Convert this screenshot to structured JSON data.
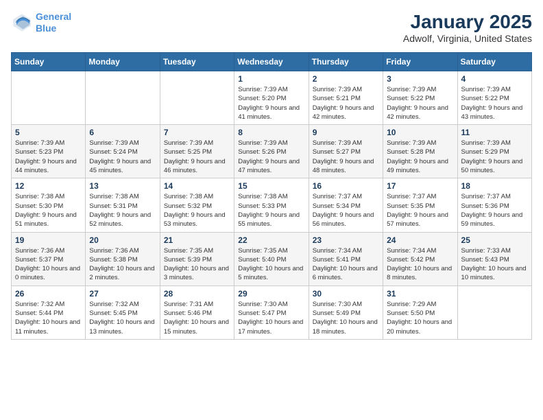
{
  "header": {
    "logo_line1": "General",
    "logo_line2": "Blue",
    "title": "January 2025",
    "subtitle": "Adwolf, Virginia, United States"
  },
  "calendar": {
    "weekdays": [
      "Sunday",
      "Monday",
      "Tuesday",
      "Wednesday",
      "Thursday",
      "Friday",
      "Saturday"
    ],
    "weeks": [
      [
        {
          "day": "",
          "text": ""
        },
        {
          "day": "",
          "text": ""
        },
        {
          "day": "",
          "text": ""
        },
        {
          "day": "1",
          "text": "Sunrise: 7:39 AM\nSunset: 5:20 PM\nDaylight: 9 hours and 41 minutes."
        },
        {
          "day": "2",
          "text": "Sunrise: 7:39 AM\nSunset: 5:21 PM\nDaylight: 9 hours and 42 minutes."
        },
        {
          "day": "3",
          "text": "Sunrise: 7:39 AM\nSunset: 5:22 PM\nDaylight: 9 hours and 42 minutes."
        },
        {
          "day": "4",
          "text": "Sunrise: 7:39 AM\nSunset: 5:22 PM\nDaylight: 9 hours and 43 minutes."
        }
      ],
      [
        {
          "day": "5",
          "text": "Sunrise: 7:39 AM\nSunset: 5:23 PM\nDaylight: 9 hours and 44 minutes."
        },
        {
          "day": "6",
          "text": "Sunrise: 7:39 AM\nSunset: 5:24 PM\nDaylight: 9 hours and 45 minutes."
        },
        {
          "day": "7",
          "text": "Sunrise: 7:39 AM\nSunset: 5:25 PM\nDaylight: 9 hours and 46 minutes."
        },
        {
          "day": "8",
          "text": "Sunrise: 7:39 AM\nSunset: 5:26 PM\nDaylight: 9 hours and 47 minutes."
        },
        {
          "day": "9",
          "text": "Sunrise: 7:39 AM\nSunset: 5:27 PM\nDaylight: 9 hours and 48 minutes."
        },
        {
          "day": "10",
          "text": "Sunrise: 7:39 AM\nSunset: 5:28 PM\nDaylight: 9 hours and 49 minutes."
        },
        {
          "day": "11",
          "text": "Sunrise: 7:39 AM\nSunset: 5:29 PM\nDaylight: 9 hours and 50 minutes."
        }
      ],
      [
        {
          "day": "12",
          "text": "Sunrise: 7:38 AM\nSunset: 5:30 PM\nDaylight: 9 hours and 51 minutes."
        },
        {
          "day": "13",
          "text": "Sunrise: 7:38 AM\nSunset: 5:31 PM\nDaylight: 9 hours and 52 minutes."
        },
        {
          "day": "14",
          "text": "Sunrise: 7:38 AM\nSunset: 5:32 PM\nDaylight: 9 hours and 53 minutes."
        },
        {
          "day": "15",
          "text": "Sunrise: 7:38 AM\nSunset: 5:33 PM\nDaylight: 9 hours and 55 minutes."
        },
        {
          "day": "16",
          "text": "Sunrise: 7:37 AM\nSunset: 5:34 PM\nDaylight: 9 hours and 56 minutes."
        },
        {
          "day": "17",
          "text": "Sunrise: 7:37 AM\nSunset: 5:35 PM\nDaylight: 9 hours and 57 minutes."
        },
        {
          "day": "18",
          "text": "Sunrise: 7:37 AM\nSunset: 5:36 PM\nDaylight: 9 hours and 59 minutes."
        }
      ],
      [
        {
          "day": "19",
          "text": "Sunrise: 7:36 AM\nSunset: 5:37 PM\nDaylight: 10 hours and 0 minutes."
        },
        {
          "day": "20",
          "text": "Sunrise: 7:36 AM\nSunset: 5:38 PM\nDaylight: 10 hours and 2 minutes."
        },
        {
          "day": "21",
          "text": "Sunrise: 7:35 AM\nSunset: 5:39 PM\nDaylight: 10 hours and 3 minutes."
        },
        {
          "day": "22",
          "text": "Sunrise: 7:35 AM\nSunset: 5:40 PM\nDaylight: 10 hours and 5 minutes."
        },
        {
          "day": "23",
          "text": "Sunrise: 7:34 AM\nSunset: 5:41 PM\nDaylight: 10 hours and 6 minutes."
        },
        {
          "day": "24",
          "text": "Sunrise: 7:34 AM\nSunset: 5:42 PM\nDaylight: 10 hours and 8 minutes."
        },
        {
          "day": "25",
          "text": "Sunrise: 7:33 AM\nSunset: 5:43 PM\nDaylight: 10 hours and 10 minutes."
        }
      ],
      [
        {
          "day": "26",
          "text": "Sunrise: 7:32 AM\nSunset: 5:44 PM\nDaylight: 10 hours and 11 minutes."
        },
        {
          "day": "27",
          "text": "Sunrise: 7:32 AM\nSunset: 5:45 PM\nDaylight: 10 hours and 13 minutes."
        },
        {
          "day": "28",
          "text": "Sunrise: 7:31 AM\nSunset: 5:46 PM\nDaylight: 10 hours and 15 minutes."
        },
        {
          "day": "29",
          "text": "Sunrise: 7:30 AM\nSunset: 5:47 PM\nDaylight: 10 hours and 17 minutes."
        },
        {
          "day": "30",
          "text": "Sunrise: 7:30 AM\nSunset: 5:49 PM\nDaylight: 10 hours and 18 minutes."
        },
        {
          "day": "31",
          "text": "Sunrise: 7:29 AM\nSunset: 5:50 PM\nDaylight: 10 hours and 20 minutes."
        },
        {
          "day": "",
          "text": ""
        }
      ]
    ]
  }
}
